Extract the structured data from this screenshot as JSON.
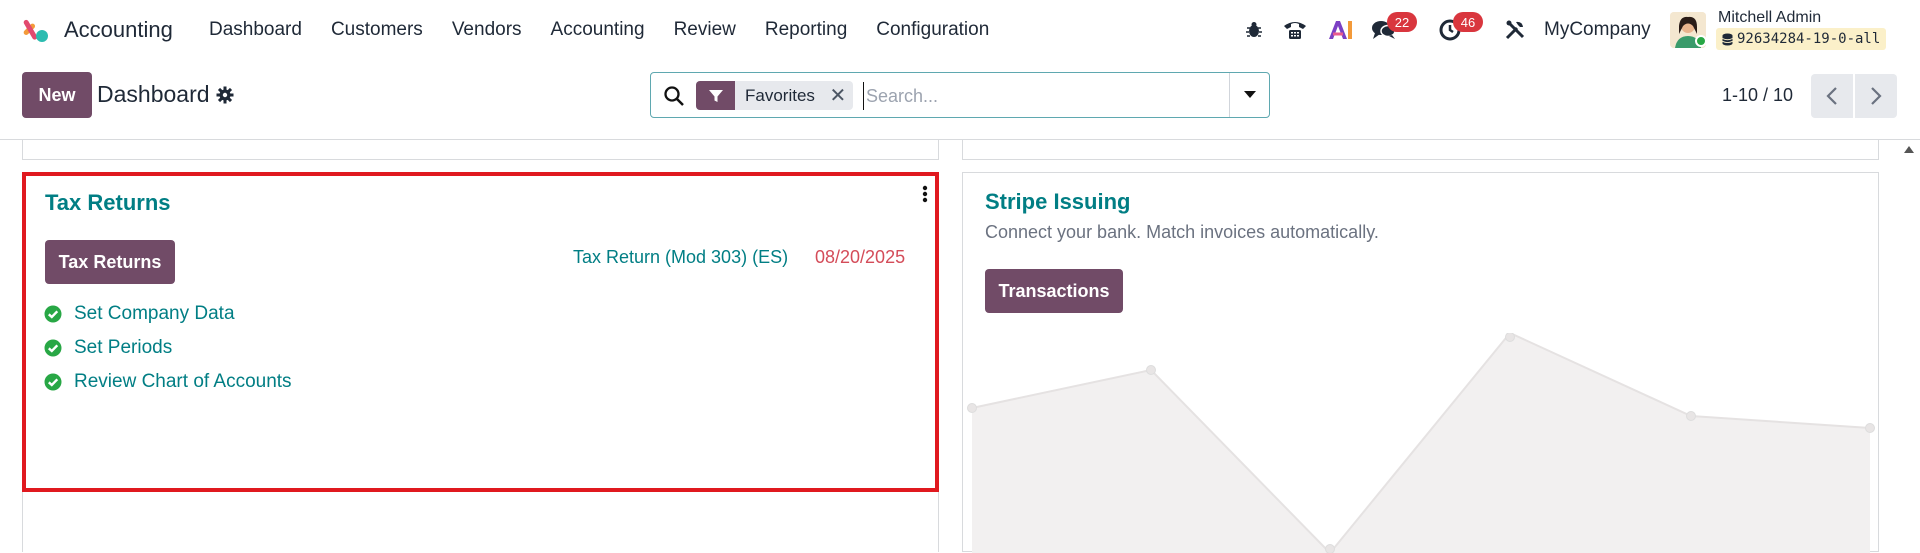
{
  "navbar": {
    "app_name": "Accounting",
    "menu": [
      "Dashboard",
      "Customers",
      "Vendors",
      "Accounting",
      "Review",
      "Reporting",
      "Configuration"
    ],
    "discuss_count": "22",
    "activity_count": "46",
    "company": "MyCompany",
    "user_name": "Mitchell Admin",
    "db_name": "92634284-19-0-all"
  },
  "control_panel": {
    "new_label": "New",
    "title": "Dashboard",
    "facet_label": "Favorites",
    "search_placeholder": "Search...",
    "pager_value": "1-10 / 10"
  },
  "tax_card": {
    "title": "Tax Returns",
    "button_label": "Tax Returns",
    "return_name": "Tax Return (Mod 303) (ES)",
    "return_date": "08/20/2025",
    "steps": [
      "Set Company Data",
      "Set Periods",
      "Review Chart of Accounts"
    ]
  },
  "stripe_card": {
    "title": "Stripe Issuing",
    "subtitle": "Connect your bank. Match invoices automatically.",
    "button_label": "Transactions"
  },
  "colors": {
    "brand": "#714b67",
    "link": "#017e84",
    "highlight": "#e0191f",
    "overdue": "#d44c59",
    "badge": "#d9363e"
  }
}
